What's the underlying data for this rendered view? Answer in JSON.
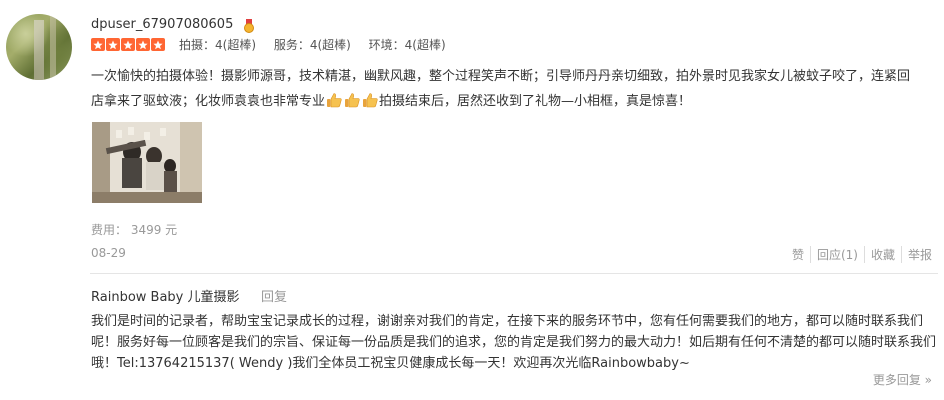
{
  "review": {
    "username": "dpuser_67907080605",
    "rating_stars": 5,
    "scores": [
      "拍摄：4(超棒)",
      "服务：4(超棒)",
      "环境：4(超棒)"
    ],
    "text_part1": "一次愉快的拍摄体验！摄影师源哥，技术精湛，幽默风趣，整个过程笑声不断；引导师丹丹亲切细致，拍外景时见我家女儿被蚊子咬了，连紧回店拿来了驱蚊液；化妆师袁袁也非常专业",
    "text_part2": "拍摄结束后，居然还收到了礼物—小相框，真是惊喜！",
    "cost": "费用： 3499 元",
    "date": "08-29",
    "actions": [
      "赞",
      "回应(1)",
      "收藏",
      "举报"
    ]
  },
  "reply": {
    "shop_name": "Rainbow Baby 儿童摄影",
    "reply_label": "回复",
    "text": "我们是时间的记录者，帮助宝宝记录成长的过程，谢谢亲对我们的肯定，在接下来的服务环节中，您有任何需要我们的地方，都可以随时联系我们呢！服务好每一位顾客是我们的宗旨、保证每一份品质是我们的追求，您的肯定是我们努力的最大动力！如后期有任何不清楚的都可以随时联系我们哦！Tel:13764215137( Wendy )我们全体员工祝宝贝健康成长每一天！欢迎再次光临Rainbowbaby~"
  },
  "more_replies": "更多回复 »",
  "colors": {
    "star": "#ff6633",
    "muted": "#999999",
    "text": "#333333"
  }
}
